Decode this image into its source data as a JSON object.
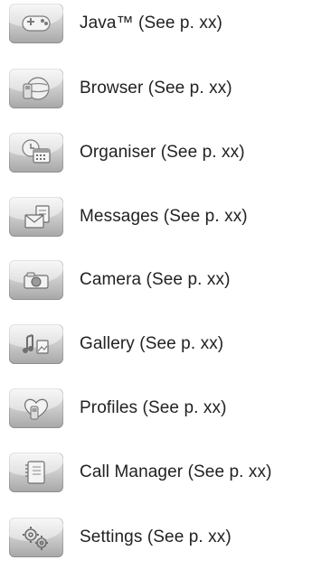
{
  "menu": {
    "items": [
      {
        "label": "Java™ (See p. xx)",
        "icon": "java-game-controller-icon"
      },
      {
        "label": "Browser (See p. xx)",
        "icon": "browser-globe-icon"
      },
      {
        "label": "Organiser (See p. xx)",
        "icon": "organiser-calendar-icon"
      },
      {
        "label": "Messages (See p. xx)",
        "icon": "messages-envelope-icon"
      },
      {
        "label": "Camera (See p. xx)",
        "icon": "camera-icon"
      },
      {
        "label": "Gallery (See p. xx)",
        "icon": "gallery-media-icon"
      },
      {
        "label": "Profiles (See p. xx)",
        "icon": "profiles-heart-phone-icon"
      },
      {
        "label": "Call Manager (See p. xx)",
        "icon": "call-manager-notebook-icon"
      },
      {
        "label": "Settings (See p. xx)",
        "icon": "settings-gears-icon"
      }
    ]
  }
}
